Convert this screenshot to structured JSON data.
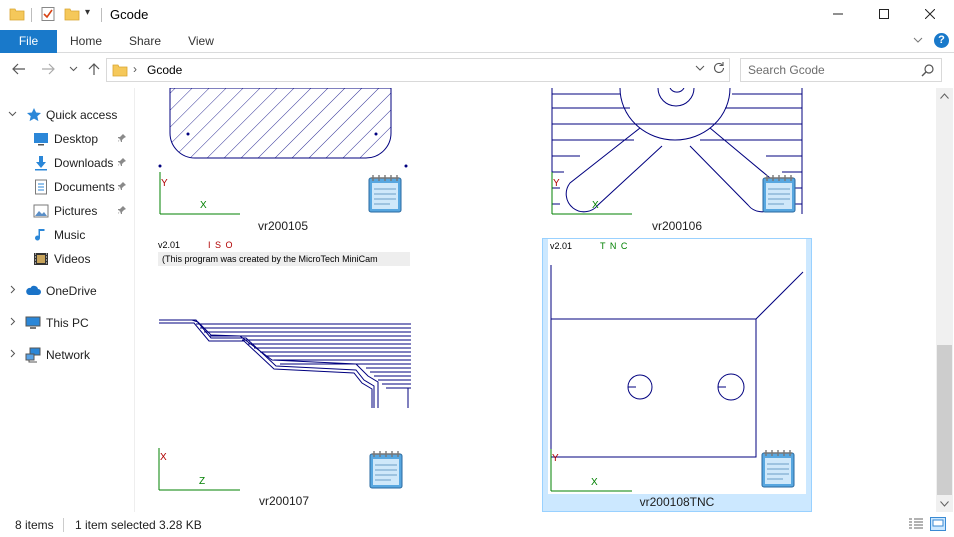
{
  "window": {
    "title": "Gcode"
  },
  "ribbon": {
    "tabs": [
      {
        "label": "File"
      },
      {
        "label": "Home"
      },
      {
        "label": "Share"
      },
      {
        "label": "View"
      }
    ]
  },
  "address": {
    "path": "Gcode",
    "search_placeholder": "Search Gcode"
  },
  "nav": {
    "quick_access": "Quick access",
    "items": [
      {
        "label": "Desktop",
        "icon": "desktop-icon",
        "pinned": true
      },
      {
        "label": "Downloads",
        "icon": "downloads-icon",
        "pinned": true
      },
      {
        "label": "Documents",
        "icon": "documents-icon",
        "pinned": true
      },
      {
        "label": "Pictures",
        "icon": "pictures-icon",
        "pinned": true
      },
      {
        "label": "Music",
        "icon": "music-icon",
        "pinned": false
      },
      {
        "label": "Videos",
        "icon": "videos-icon",
        "pinned": false
      }
    ],
    "roots": [
      {
        "label": "OneDrive",
        "icon": "onedrive-icon"
      },
      {
        "label": "This PC",
        "icon": "this-pc-icon"
      },
      {
        "label": "Network",
        "icon": "network-icon"
      }
    ]
  },
  "files": [
    {
      "name": "vr200105",
      "axis_v": "Y",
      "axis_h": "X"
    },
    {
      "name": "vr200106",
      "axis_v": "Y",
      "axis_h": "X"
    },
    {
      "name": "vr200107",
      "version": "v2.01",
      "mode": "I S O",
      "comment": "(This program was created by the MicroTech MiniCam",
      "axis_v": "X",
      "axis_h": "Z"
    },
    {
      "name": "vr200108TNC",
      "version": "v2.01",
      "mode": "T N C",
      "axis_v": "Y",
      "axis_h": "X",
      "selected": true
    }
  ],
  "status": {
    "item_count": "8 items",
    "selection": "1 item selected  3.28 KB"
  },
  "colors": {
    "accent": "#1979ca",
    "selection": "#cce8ff",
    "drawing": "#00007f",
    "axis": "#008000",
    "axis_label_red": "#b00000"
  }
}
